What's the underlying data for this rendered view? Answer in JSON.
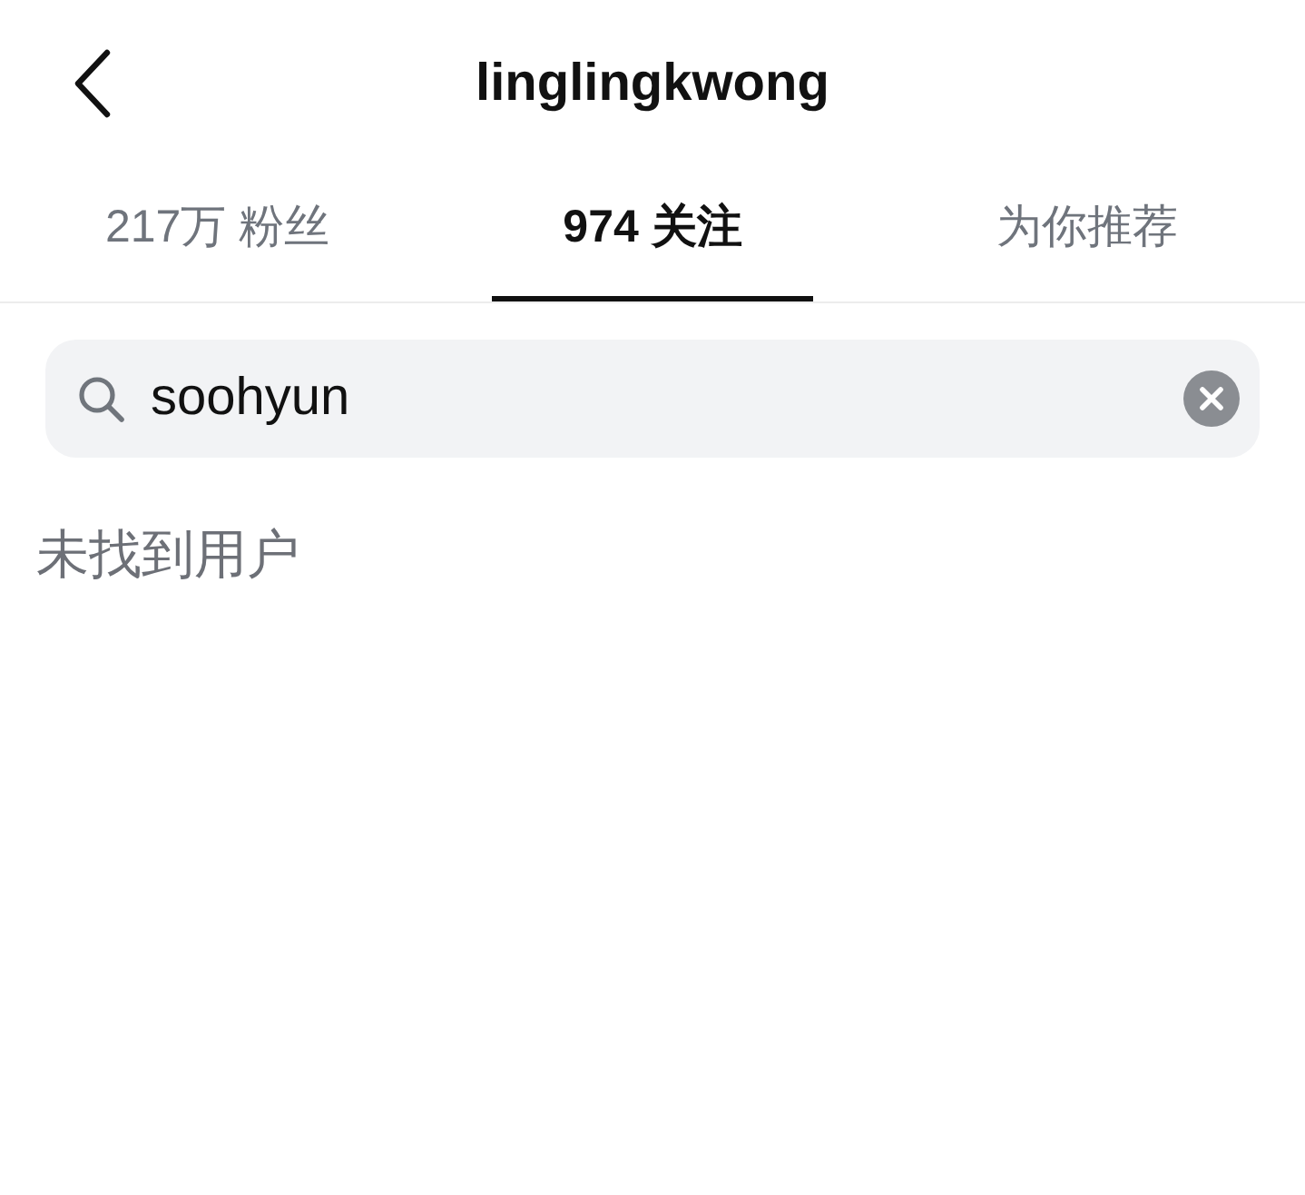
{
  "header": {
    "title": "linglingkwong"
  },
  "tabs": [
    {
      "label": "217万 粉丝",
      "selected": false
    },
    {
      "label": "974 关注",
      "selected": true
    },
    {
      "label": "为你推荐",
      "selected": false
    }
  ],
  "search": {
    "value": "soohyun"
  },
  "message": "未找到用户"
}
